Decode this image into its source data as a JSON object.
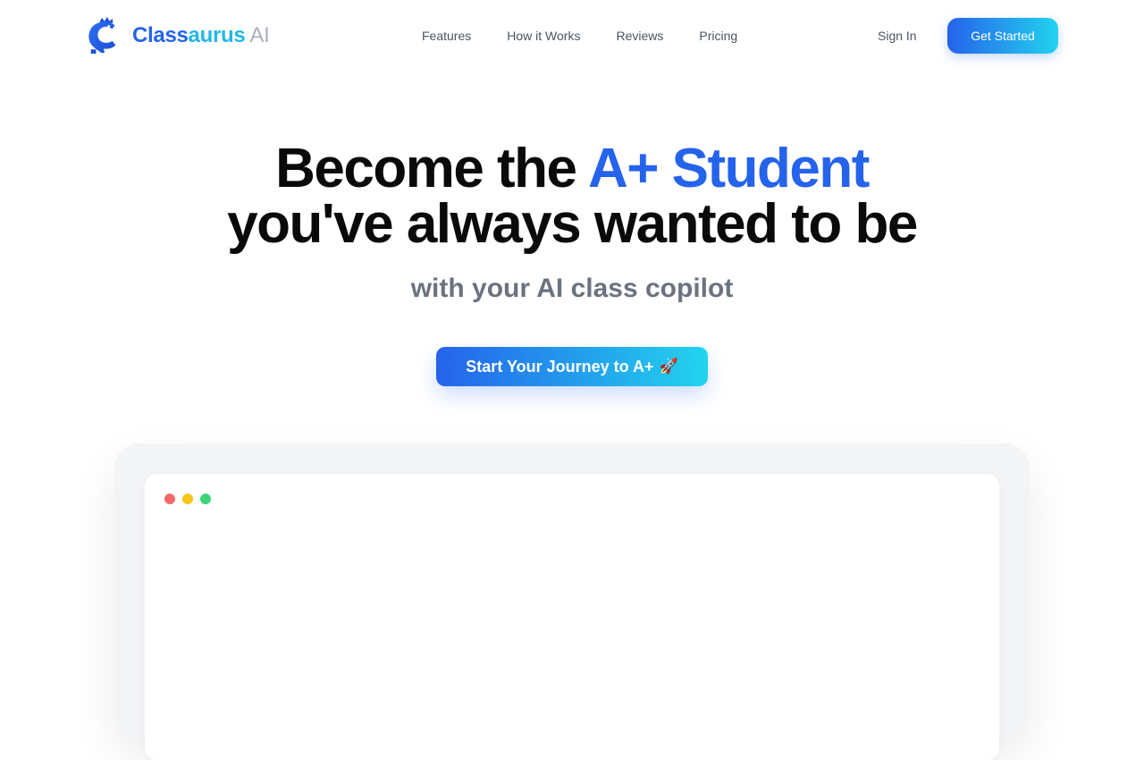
{
  "brand": {
    "part1": "Class",
    "part2": "aurus",
    "part3": "AI",
    "colors": {
      "primary": "#2563eb",
      "secondary": "#22b8e6",
      "muted": "#a8b0bd"
    },
    "icon": "dino-logo-icon"
  },
  "nav": {
    "links": [
      "Features",
      "How it Works",
      "Reviews",
      "Pricing"
    ],
    "sign_in": "Sign In",
    "get_started": "Get Started"
  },
  "hero": {
    "title_part1": "Become the ",
    "title_accent": "A+ Student",
    "title_line2": "you've always wanted to be",
    "subtitle": "with your AI class copilot",
    "cta_label": "Start Your Journey to A+",
    "cta_icon": "🚀"
  },
  "preview": {
    "window_controls": [
      "close-dot",
      "minimize-dot",
      "maximize-dot"
    ],
    "dot_colors": [
      "#f06a6a",
      "#f5c518",
      "#3dd47a"
    ]
  }
}
